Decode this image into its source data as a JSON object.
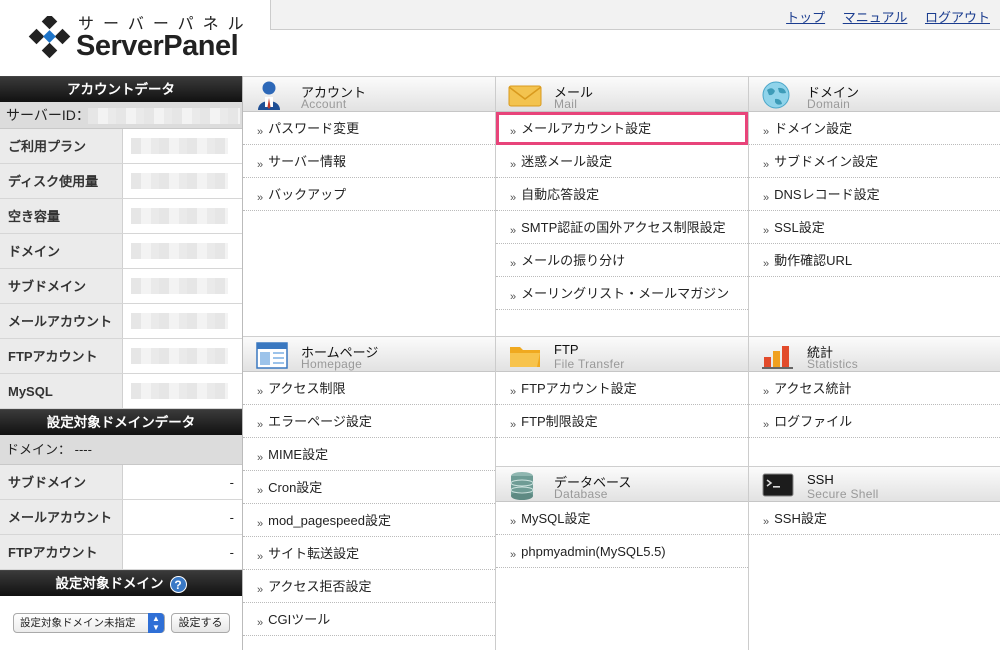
{
  "logo": {
    "kana": "サーバーパネル",
    "name": "ServerPanel"
  },
  "top_links": [
    "トップ",
    "マニュアル",
    "ログアウト"
  ],
  "sidebar": {
    "account_header": "アカウントデータ",
    "server_id_label": "サーバーID：",
    "account_rows": [
      {
        "label": "ご利用プラン"
      },
      {
        "label": "ディスク使用量"
      },
      {
        "label": "空き容量"
      },
      {
        "label": "ドメイン"
      },
      {
        "label": "サブドメイン"
      },
      {
        "label": "メールアカウント"
      },
      {
        "label": "FTPアカウント"
      },
      {
        "label": "MySQL"
      }
    ],
    "domain_data_header": "設定対象ドメインデータ",
    "domain_line": "ドメイン：  ----",
    "domain_rows": [
      {
        "label": "サブドメイン",
        "value": "-"
      },
      {
        "label": "メールアカウント",
        "value": "-"
      },
      {
        "label": "FTPアカウント",
        "value": "-"
      }
    ],
    "target_domain_header": "設定対象ドメイン",
    "help_glyph": "?",
    "select_value": "設定対象ドメイン未指定",
    "set_button": "設定する"
  },
  "panels": {
    "account": {
      "title": "アカウント",
      "subtitle": "Account",
      "icon": "user-icon",
      "items": [
        "パスワード変更",
        "サーバー情報",
        "バックアップ"
      ]
    },
    "mail": {
      "title": "メール",
      "subtitle": "Mail",
      "icon": "mail-envelope-icon",
      "items": [
        "メールアカウント設定",
        "迷惑メール設定",
        "自動応答設定",
        "SMTP認証の国外アクセス制限設定",
        "メールの振り分け",
        "メーリングリスト・メールマガジン"
      ]
    },
    "domain": {
      "title": "ドメイン",
      "subtitle": "Domain",
      "icon": "globe-icon",
      "items": [
        "ドメイン設定",
        "サブドメイン設定",
        "DNSレコード設定",
        "SSL設定",
        "動作確認URL"
      ]
    },
    "homepage": {
      "title": "ホームページ",
      "subtitle": "Homepage",
      "icon": "webpage-icon",
      "items": [
        "アクセス制限",
        "エラーページ設定",
        "MIME設定",
        "Cron設定",
        "mod_pagespeed設定",
        "サイト転送設定",
        "アクセス拒否設定",
        "CGIツール"
      ]
    },
    "ftp": {
      "title": "FTP",
      "subtitle": "File Transfer",
      "icon": "folder-icon",
      "items": [
        "FTPアカウント設定",
        "FTP制限設定"
      ]
    },
    "stats": {
      "title": "統計",
      "subtitle": "Statistics",
      "icon": "chart-icon",
      "items": [
        "アクセス統計",
        "ログファイル"
      ]
    },
    "database": {
      "title": "データベース",
      "subtitle": "Database",
      "icon": "database-icon",
      "items": [
        "MySQL設定",
        "phpmyadmin(MySQL5.5)"
      ]
    },
    "ssh": {
      "title": "SSH",
      "subtitle": "Secure Shell",
      "icon": "terminal-icon",
      "items": [
        "SSH設定"
      ]
    }
  },
  "highlight_color": "#e8447a"
}
